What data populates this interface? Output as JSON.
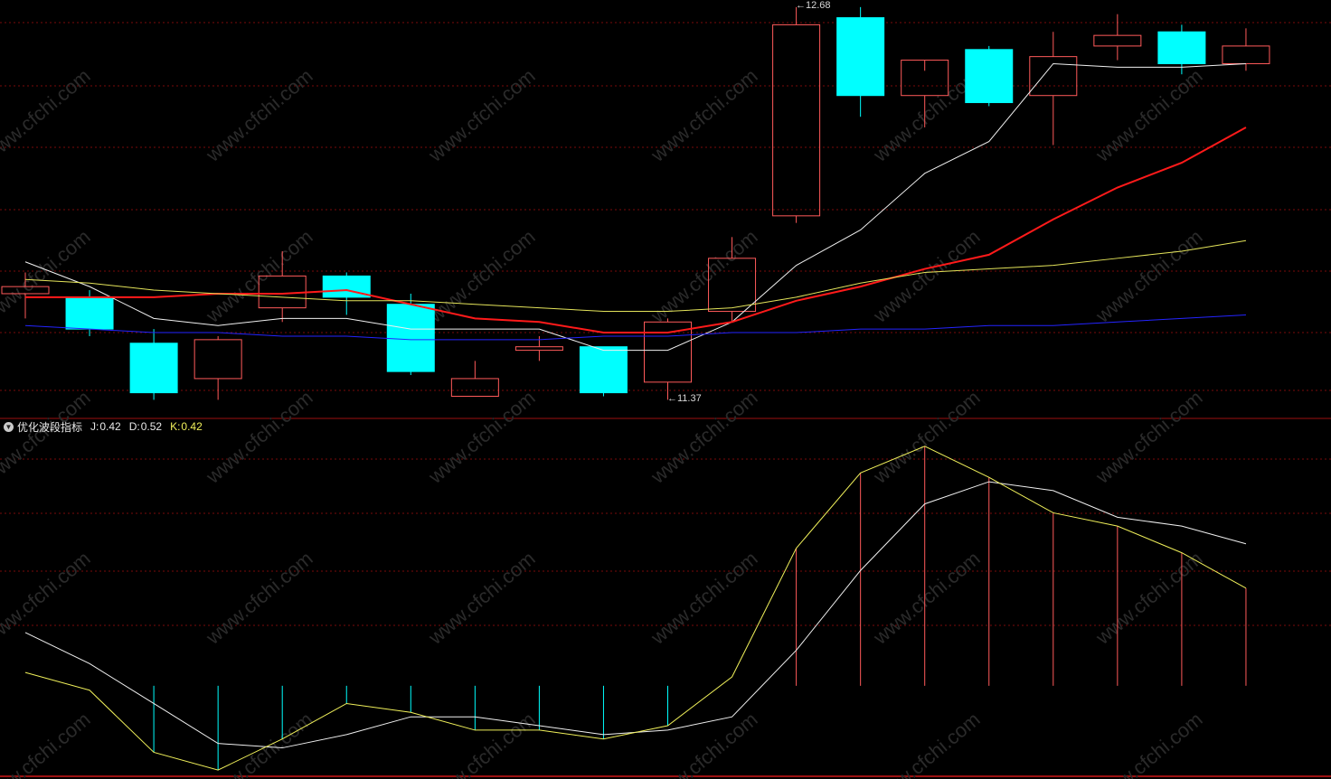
{
  "colors": {
    "background": "#000000",
    "grid": "#7a0a0a",
    "divider": "#9b1111",
    "up": "#ff5a5a",
    "down": "#00ffff",
    "ma_white": "#f0f0f0",
    "ma_red": "#ff1a1a",
    "ma_yellow": "#e4e45a",
    "ma_blue": "#2424ff",
    "osc_white": "#f0f0f0",
    "osc_yellow": "#f0f05a",
    "watermark": "#2a2a2a"
  },
  "watermark": "www.cfchi.com",
  "price_panel": {
    "high_label": "12.68",
    "low_label": "11.37"
  },
  "indicator_panel": {
    "icon": "chevron-down-icon",
    "name": "优化波段指标",
    "j_label": "J:",
    "j_value": "0.42",
    "d_label": "D:",
    "d_value": "0.52",
    "k_label": "K:",
    "k_value": "0.42"
  },
  "chart_data": [
    {
      "type": "candlestick",
      "y_scale_note": "price",
      "candles": [
        {
          "o": 11.87,
          "h": 11.93,
          "l": 11.8,
          "c": 11.89,
          "dir": "up"
        },
        {
          "o": 11.86,
          "h": 11.88,
          "l": 11.75,
          "c": 11.77,
          "dir": "down"
        },
        {
          "o": 11.73,
          "h": 11.77,
          "l": 11.57,
          "c": 11.59,
          "dir": "down"
        },
        {
          "o": 11.63,
          "h": 11.75,
          "l": 11.57,
          "c": 11.74,
          "dir": "up"
        },
        {
          "o": 11.83,
          "h": 11.99,
          "l": 11.79,
          "c": 11.92,
          "dir": "up"
        },
        {
          "o": 11.92,
          "h": 11.93,
          "l": 11.81,
          "c": 11.86,
          "dir": "down"
        },
        {
          "o": 11.84,
          "h": 11.87,
          "l": 11.64,
          "c": 11.65,
          "dir": "down"
        },
        {
          "o": 11.58,
          "h": 11.68,
          "l": 11.58,
          "c": 11.63,
          "dir": "up"
        },
        {
          "o": 11.72,
          "h": 11.75,
          "l": 11.68,
          "c": 11.71,
          "dir": "up"
        },
        {
          "o": 11.72,
          "h": 11.72,
          "l": 11.58,
          "c": 11.59,
          "dir": "down"
        },
        {
          "o": 11.62,
          "h": 11.8,
          "l": 11.57,
          "c": 11.79,
          "dir": "up"
        },
        {
          "o": 11.82,
          "h": 12.03,
          "l": 11.79,
          "c": 11.97,
          "dir": "up"
        },
        {
          "o": 12.09,
          "h": 12.68,
          "l": 12.07,
          "c": 12.63,
          "dir": "up"
        },
        {
          "o": 12.65,
          "h": 12.68,
          "l": 12.37,
          "c": 12.43,
          "dir": "down"
        },
        {
          "o": 12.43,
          "h": 12.5,
          "l": 12.34,
          "c": 12.53,
          "dir": "up"
        },
        {
          "o": 12.56,
          "h": 12.57,
          "l": 12.4,
          "c": 12.41,
          "dir": "down"
        },
        {
          "o": 12.43,
          "h": 12.61,
          "l": 12.29,
          "c": 12.54,
          "dir": "up"
        },
        {
          "o": 12.57,
          "h": 12.66,
          "l": 12.53,
          "c": 12.6,
          "dir": "up"
        },
        {
          "o": 12.61,
          "h": 12.63,
          "l": 12.49,
          "c": 12.52,
          "dir": "down"
        },
        {
          "o": 12.52,
          "h": 12.62,
          "l": 12.5,
          "c": 12.57,
          "dir": "up"
        }
      ],
      "series": [
        {
          "color": "ma_white",
          "values": [
            11.96,
            11.89,
            11.8,
            11.78,
            11.8,
            11.8,
            11.77,
            11.77,
            11.77,
            11.71,
            11.71,
            11.79,
            11.95,
            12.05,
            12.21,
            12.3,
            12.52,
            12.51,
            12.51,
            12.52
          ]
        },
        {
          "color": "ma_red",
          "values": [
            11.86,
            11.86,
            11.86,
            11.87,
            11.87,
            11.88,
            11.84,
            11.8,
            11.79,
            11.76,
            11.76,
            11.79,
            11.85,
            11.89,
            11.94,
            11.98,
            12.08,
            12.17,
            12.24,
            12.34
          ]
        },
        {
          "color": "ma_yellow",
          "values": [
            11.91,
            11.9,
            11.88,
            11.87,
            11.86,
            11.85,
            11.85,
            11.84,
            11.83,
            11.82,
            11.82,
            11.83,
            11.86,
            11.9,
            11.93,
            11.94,
            11.95,
            11.97,
            11.99,
            12.02
          ]
        },
        {
          "color": "ma_blue",
          "values": [
            11.78,
            11.77,
            11.76,
            11.76,
            11.75,
            11.75,
            11.74,
            11.74,
            11.74,
            11.75,
            11.75,
            11.76,
            11.76,
            11.77,
            11.77,
            11.78,
            11.78,
            11.79,
            11.8,
            11.81
          ]
        }
      ]
    },
    {
      "type": "line",
      "y_range": [
        0,
        1
      ],
      "series": [
        {
          "color": "osc_white",
          "values": [
            0.32,
            0.25,
            0.16,
            0.07,
            0.06,
            0.09,
            0.13,
            0.13,
            0.11,
            0.09,
            0.1,
            0.13,
            0.28,
            0.46,
            0.61,
            0.66,
            0.64,
            0.58,
            0.56,
            0.52
          ]
        },
        {
          "color": "osc_yellow",
          "values": [
            0.23,
            0.19,
            0.05,
            0.01,
            0.08,
            0.16,
            0.14,
            0.1,
            0.1,
            0.08,
            0.11,
            0.22,
            0.51,
            0.68,
            0.74,
            0.67,
            0.59,
            0.56,
            0.5,
            0.42
          ]
        }
      ],
      "bars": [
        {
          "from": 0.23,
          "to": 0.23,
          "color": "down"
        },
        {
          "from": 0.19,
          "to": 0.19,
          "color": "down"
        },
        {
          "from": 0.05,
          "to": 0.2,
          "color": "down"
        },
        {
          "from": 0.01,
          "to": 0.2,
          "color": "down"
        },
        {
          "from": 0.08,
          "to": 0.2,
          "color": "down"
        },
        {
          "from": 0.16,
          "to": 0.2,
          "color": "down"
        },
        {
          "from": 0.14,
          "to": 0.2,
          "color": "down"
        },
        {
          "from": 0.1,
          "to": 0.2,
          "color": "down"
        },
        {
          "from": 0.1,
          "to": 0.2,
          "color": "down"
        },
        {
          "from": 0.08,
          "to": 0.2,
          "color": "down"
        },
        {
          "from": 0.11,
          "to": 0.2,
          "color": "down"
        },
        {
          "from": 0.2,
          "to": 0.2,
          "color": "up"
        },
        {
          "from": 0.2,
          "to": 0.51,
          "color": "up"
        },
        {
          "from": 0.2,
          "to": 0.68,
          "color": "up"
        },
        {
          "from": 0.2,
          "to": 0.74,
          "color": "up"
        },
        {
          "from": 0.2,
          "to": 0.67,
          "color": "up"
        },
        {
          "from": 0.2,
          "to": 0.59,
          "color": "up"
        },
        {
          "from": 0.2,
          "to": 0.56,
          "color": "up"
        },
        {
          "from": 0.2,
          "to": 0.5,
          "color": "up"
        },
        {
          "from": 0.2,
          "to": 0.42,
          "color": "up"
        }
      ]
    }
  ]
}
